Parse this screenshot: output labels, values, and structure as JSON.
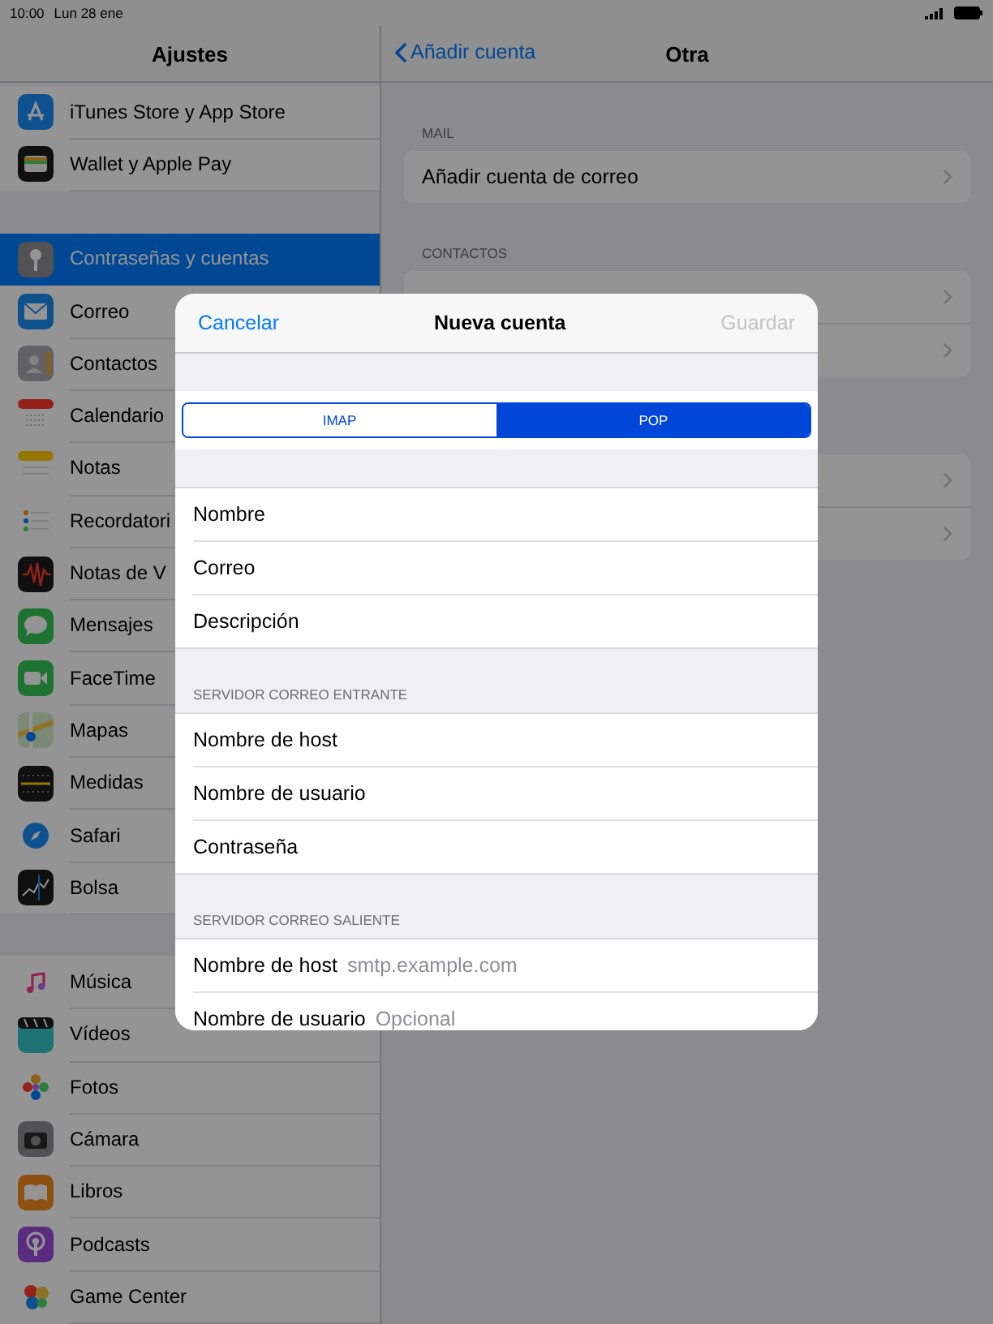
{
  "status_bar": {
    "time": "10:00",
    "date": "Lun 28 ene"
  },
  "sidebar": {
    "title": "Ajustes",
    "groups": [
      {
        "items": [
          {
            "label": "iTunes Store y App Store",
            "selected": false
          },
          {
            "label": "Wallet y Apple Pay",
            "selected": false
          }
        ]
      },
      {
        "items": [
          {
            "label": "Contraseñas y cuentas",
            "selected": true
          },
          {
            "label": "Correo",
            "selected": false
          },
          {
            "label": "Contactos",
            "selected": false
          },
          {
            "label": "Calendario",
            "selected": false
          },
          {
            "label": "Notas",
            "selected": false
          },
          {
            "label": "Recordatori",
            "selected": false
          },
          {
            "label": "Notas de V",
            "selected": false
          },
          {
            "label": "Mensajes",
            "selected": false
          },
          {
            "label": "FaceTime",
            "selected": false
          },
          {
            "label": "Mapas",
            "selected": false
          },
          {
            "label": "Medidas",
            "selected": false
          },
          {
            "label": "Safari",
            "selected": false
          },
          {
            "label": "Bolsa",
            "selected": false
          }
        ]
      },
      {
        "items": [
          {
            "label": "Música",
            "selected": false
          },
          {
            "label": "Vídeos",
            "selected": false
          },
          {
            "label": "Fotos",
            "selected": false
          },
          {
            "label": "Cámara",
            "selected": false
          },
          {
            "label": "Libros",
            "selected": false
          },
          {
            "label": "Podcasts",
            "selected": false
          },
          {
            "label": "Game Center",
            "selected": false
          }
        ]
      }
    ]
  },
  "detail": {
    "back": "Añadir cuenta",
    "title": "Otra",
    "sections": [
      {
        "header": "MAIL",
        "rows": [
          {
            "kind": "link",
            "label": "Añadir cuenta de correo"
          }
        ]
      },
      {
        "header": "CONTACTOS",
        "rows": [
          {
            "kind": "link"
          },
          {
            "kind": "link"
          }
        ]
      },
      {
        "rows": [
          {
            "kind": "link"
          },
          {
            "kind": "link"
          }
        ]
      }
    ]
  },
  "modal": {
    "cancel": "Cancelar",
    "title": "Nueva cuenta",
    "save": {
      "label": "Guardar",
      "disabled": true
    },
    "segments": [
      {
        "label": "IMAP",
        "selected": false
      },
      {
        "label": "POP",
        "selected": true
      }
    ],
    "sections": [
      {
        "rows": [
          {
            "label": "Nombre"
          },
          {
            "label": "Correo"
          },
          {
            "label": "Descripción"
          }
        ]
      },
      {
        "header": "SERVIDOR CORREO ENTRANTE",
        "rows": [
          {
            "label": "Nombre de host"
          },
          {
            "label": "Nombre de usuario"
          },
          {
            "label": "Contraseña"
          }
        ]
      },
      {
        "header": "SERVIDOR CORREO SALIENTE",
        "rows": [
          {
            "label": "Nombre de host",
            "placeholder": "smtp.example.com"
          },
          {
            "label": "Nombre de usuario",
            "placeholder": "Opcional"
          }
        ]
      }
    ]
  }
}
